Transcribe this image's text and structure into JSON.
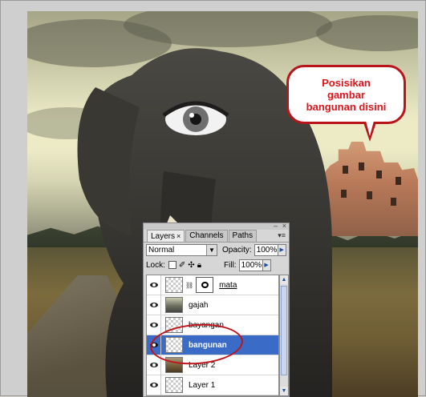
{
  "callout": {
    "text": "Posisikan\ngambar\nbangunan disini",
    "color": "#e0141a",
    "border_color": "#b8141a"
  },
  "layers_panel": {
    "tabs": [
      {
        "label": "Layers",
        "active": true,
        "close": "×"
      },
      {
        "label": "Channels",
        "active": false
      },
      {
        "label": "Paths",
        "active": false
      }
    ],
    "panel_controls": {
      "minimize": "–",
      "close": "×",
      "menu": "▾≡"
    },
    "blend_mode": "Normal",
    "opacity_label": "Opacity:",
    "opacity_value": "100%",
    "lock_label": "Lock:",
    "fill_label": "Fill:",
    "fill_value": "100%",
    "layers": [
      {
        "name": "mata",
        "thumb": "transparent",
        "has_mask": true,
        "selected": false
      },
      {
        "name": "gajah",
        "thumb": "elephant",
        "has_mask": false,
        "selected": false
      },
      {
        "name": "bayangan",
        "thumb": "transparent",
        "has_mask": false,
        "selected": false
      },
      {
        "name": "bangunan",
        "thumb": "transparent",
        "has_mask": false,
        "selected": true
      },
      {
        "name": "Layer 2",
        "thumb": "photo",
        "has_mask": false,
        "selected": false
      },
      {
        "name": "Layer 1",
        "thumb": "transparent",
        "has_mask": false,
        "selected": false
      }
    ],
    "selected_color": "#3a6bc6"
  },
  "highlight_color": "#c0141a"
}
